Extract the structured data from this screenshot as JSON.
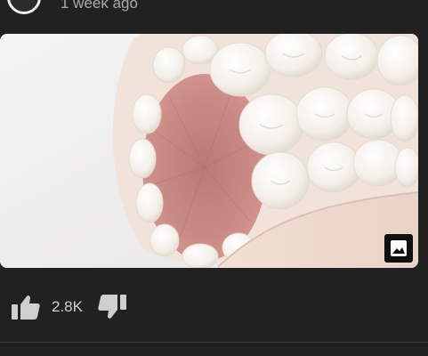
{
  "post": {
    "timestamp": "1 week ago",
    "likes": "2.8K"
  },
  "icons": {
    "avatar": "avatar-circle",
    "image_badge": "image-icon",
    "like": "thumbs-up-icon",
    "dislike": "thumbs-down-icon"
  },
  "colors": {
    "background": "#212121",
    "text_secondary": "#aaaaaa",
    "icon": "#cfcfcf"
  }
}
